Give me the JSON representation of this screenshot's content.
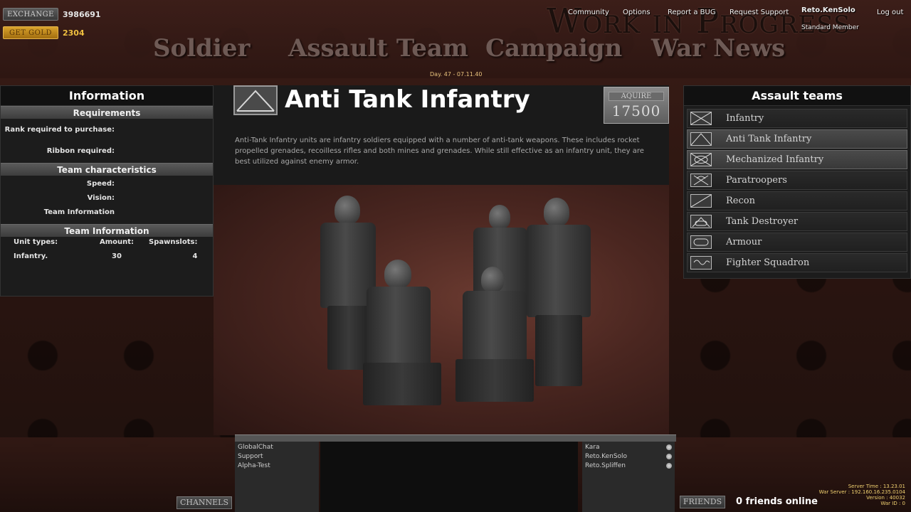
{
  "currency": {
    "exchange_label": "EXCHANGE",
    "exchange_value": "3986691",
    "gold_label": "GET GOLD",
    "gold_value": "2304"
  },
  "watermark": "Work in Progress",
  "top_links": [
    "Community",
    "Options",
    "Report a BUG",
    "Request Support",
    "Log out"
  ],
  "user": {
    "name": "Reto.KenSolo",
    "rank": "Standard Member"
  },
  "main_nav": [
    "Soldier",
    "Assault Team",
    "Campaign",
    "War News"
  ],
  "day_stamp": "Day. 47 - 07.11.40",
  "info_panel": {
    "title": "Information",
    "requirements_head": "Requirements",
    "rank_label": "Rank required to purchase:",
    "ribbon_label": "Ribbon required:",
    "characteristics_head": "Team characteristics",
    "speed_label": "Speed:",
    "vision_label": "Vision:",
    "team_info_label": "Team Information",
    "team_info_head": "Team Information",
    "columns": [
      "Unit types:",
      "Amount:",
      "Spawnslots:"
    ],
    "rows": [
      [
        "Infantry.",
        "30",
        "4"
      ]
    ]
  },
  "unit": {
    "title": "Anti Tank Infantry",
    "acquire_label": "AQUIRE",
    "price": "17500",
    "description": "Anti-Tank Infantry units are infantry soldiers equipped with  a number of anti-tank weapons. These includes rocket propelled grenades, recoilless rifles and both mines and grenades. While still effective as an infantry unit, they are best utilized against enemy armor."
  },
  "assault_teams": {
    "title": "Assault teams",
    "items": [
      "Infantry",
      "Anti Tank Infantry",
      "Mechanized Infantry",
      "Paratroopers",
      "Recon",
      "Tank Destroyer",
      "Armour",
      "Fighter Squadron"
    ]
  },
  "chat": {
    "channels": [
      "GlobalChat",
      "Support",
      "Alpha-Test"
    ],
    "users": [
      "Kara",
      "Reto.KenSolo",
      "Reto.Spliffen"
    ],
    "channels_button": "CHANNELS",
    "friends_button": "FRIENDS",
    "friends_online": "0 friends online"
  },
  "server": {
    "time": "Server Time :  13.23.01",
    "address": "War Server :  192.160.16.235.0104",
    "version": "Version :  40032",
    "war_id": "War ID :  0"
  }
}
